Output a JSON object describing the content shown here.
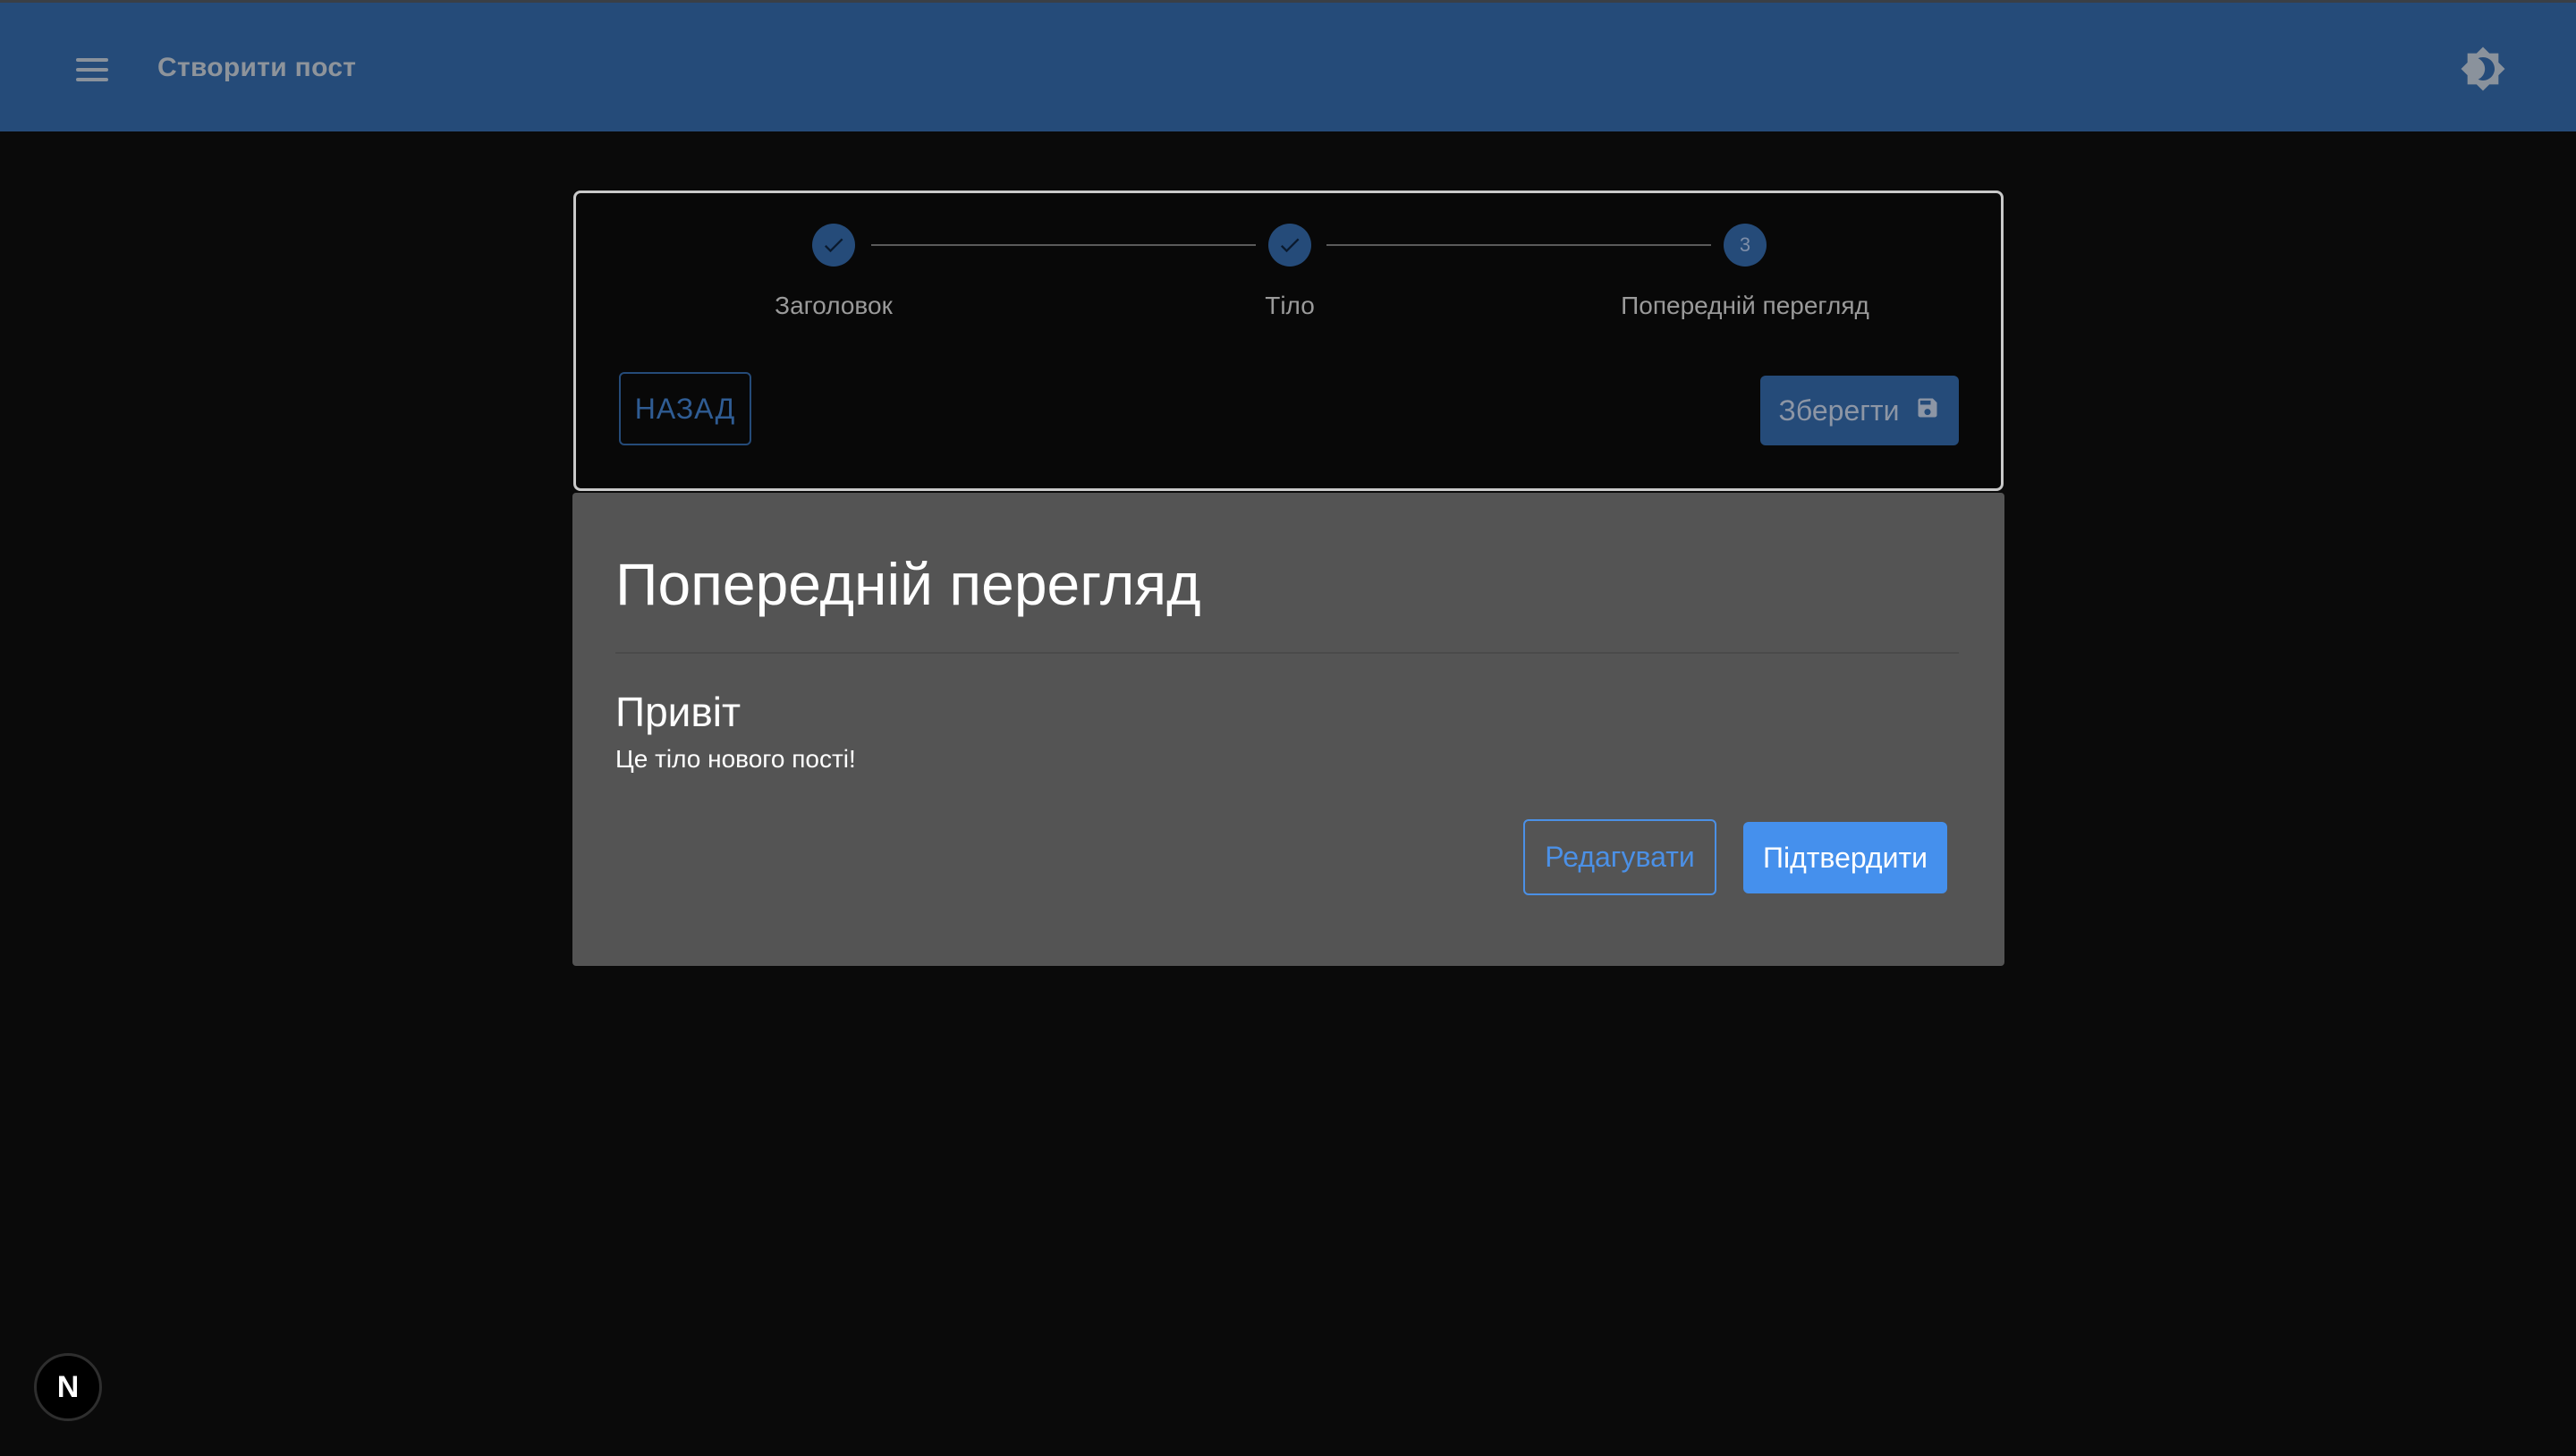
{
  "app_bar": {
    "title": "Створити пост",
    "menu_icon": "menu-icon",
    "theme_icon": "brightness-icon",
    "background": "#254b79"
  },
  "stepper": {
    "steps": [
      {
        "label": "Заголовок",
        "status": "completed",
        "icon": "check-icon"
      },
      {
        "label": "Тіло",
        "status": "completed",
        "icon": "check-icon"
      },
      {
        "label": "Попередній перегляд",
        "status": "active",
        "number": "3"
      }
    ],
    "back_label": "НАЗАД",
    "save_label": "Зберегти",
    "save_icon": "save-icon"
  },
  "preview": {
    "heading": "Попередній перегляд",
    "post_title": "Привіт",
    "post_body": "Це тіло нового пості!",
    "edit_label": "Редагувати",
    "confirm_label": "Підтвердити"
  },
  "dev_badge": {
    "letter": "N",
    "icon": "nextjs-icon"
  },
  "colors": {
    "accent": "#4590ed",
    "app_bar": "#254b79",
    "panel": "#545454",
    "background": "#0a0a0a"
  }
}
